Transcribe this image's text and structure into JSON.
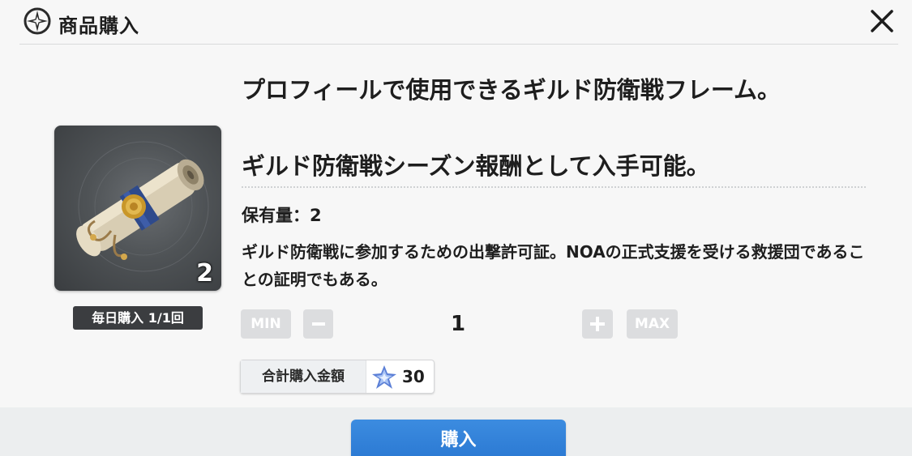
{
  "header": {
    "title": "商品購入",
    "icon": "star-compass-icon",
    "close_icon": "close-icon"
  },
  "item": {
    "image": "scroll-icon",
    "count": "2",
    "purchase_limit": "毎日購入 1/1回"
  },
  "description": {
    "line1": "プロフィールで使用できるギルド防衛戦フレーム。",
    "line2": "ギルド防衛戦シーズン報酬として入手可能。",
    "owned": "保有量：2",
    "detail": "ギルド防衛戦に参加するための出撃許可証。NOAの正式支援を受ける救援団であることの証明でもある。"
  },
  "quantity": {
    "min_label": "MIN",
    "max_label": "MAX",
    "value": "1"
  },
  "total": {
    "label": "合計購入金額",
    "currency_icon": "crystal-icon",
    "value": "30"
  },
  "footer": {
    "buy_label": "購入"
  },
  "colors": {
    "accent": "#2f80d8",
    "disabled": "#dcdddf",
    "badge": "#3b3d40"
  }
}
